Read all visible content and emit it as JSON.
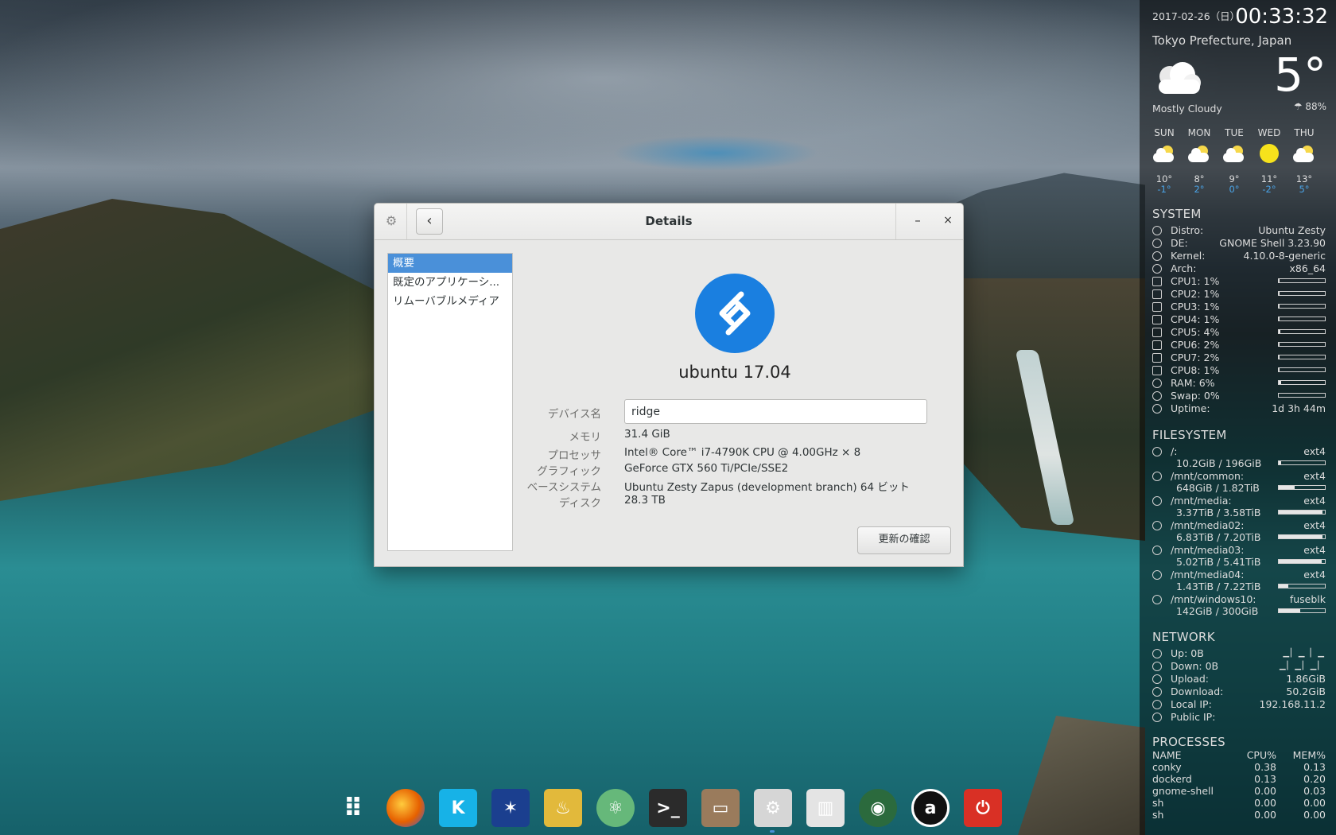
{
  "window": {
    "title": "Details",
    "sidebar_items": [
      "概要",
      "既定のアプリケーシ...",
      "リムーバブルメディア"
    ],
    "os_name": "ubuntu 17.04",
    "labels": {
      "device_name": "デバイス名",
      "memory": "メモリ",
      "processor": "プロセッサ",
      "graphics": "グラフィック",
      "base_system": "ベースシステム",
      "disk": "ディスク"
    },
    "values": {
      "device_name": "ridge",
      "memory": "31.4 GiB",
      "processor": "Intel® Core™ i7-4790K CPU @ 4.00GHz × 8",
      "graphics": "GeForce GTX 560 Ti/PCIe/SSE2",
      "base_system": "Ubuntu Zesty Zapus (development branch) 64 ビット",
      "disk": "28.3 TB"
    },
    "update_button": "更新の確認",
    "minimize_glyph": "–",
    "close_glyph": "×",
    "back_glyph": "‹",
    "gear_glyph": "⚙"
  },
  "conky": {
    "date": "2017-02-26（日）",
    "time": "00:33:32",
    "location": "Tokyo Prefecture, Japan",
    "temp": "5°",
    "condition": "Mostly Cloudy",
    "humidity": "☂ 88%",
    "forecast": [
      {
        "day": "SUN",
        "hi": "10°",
        "lo": "-1°",
        "icon": "partly-cloudy-icon"
      },
      {
        "day": "MON",
        "hi": "8°",
        "lo": "2°",
        "icon": "partly-cloudy-icon"
      },
      {
        "day": "TUE",
        "hi": "9°",
        "lo": "0°",
        "icon": "partly-cloudy-icon"
      },
      {
        "day": "WED",
        "hi": "11°",
        "lo": "-2°",
        "icon": "sunny-icon"
      },
      {
        "day": "THU",
        "hi": "13°",
        "lo": "5°",
        "icon": "partly-cloudy-icon"
      }
    ],
    "system_title": "SYSTEM",
    "system": [
      {
        "label": "Distro:",
        "value": "Ubuntu Zesty"
      },
      {
        "label": "DE:",
        "value": "GNOME Shell 3.23.90"
      },
      {
        "label": "Kernel:",
        "value": "4.10.0-8-generic"
      },
      {
        "label": "Arch:",
        "value": "x86_64"
      }
    ],
    "cpus": [
      {
        "label": "CPU1: 1%",
        "pct": 1
      },
      {
        "label": "CPU2: 1%",
        "pct": 1
      },
      {
        "label": "CPU3: 1%",
        "pct": 1
      },
      {
        "label": "CPU4: 1%",
        "pct": 1
      },
      {
        "label": "CPU5: 4%",
        "pct": 4
      },
      {
        "label": "CPU6: 2%",
        "pct": 2
      },
      {
        "label": "CPU7: 2%",
        "pct": 2
      },
      {
        "label": "CPU8: 1%",
        "pct": 1
      }
    ],
    "ram": {
      "label": "RAM: 6%",
      "pct": 6
    },
    "swap": {
      "label": "Swap: 0%",
      "pct": 0
    },
    "uptime": {
      "label": "Uptime:",
      "value": "1d 3h 44m"
    },
    "fs_title": "FILESYSTEM",
    "filesystems": [
      {
        "mount": "/:",
        "type": "ext4",
        "usage": "10.2GiB / 196GiB",
        "pct": 5
      },
      {
        "mount": "/mnt/common:",
        "type": "ext4",
        "usage": "648GiB / 1.82TiB",
        "pct": 35
      },
      {
        "mount": "/mnt/media:",
        "type": "ext4",
        "usage": "3.37TiB / 3.58TiB",
        "pct": 94
      },
      {
        "mount": "/mnt/media02:",
        "type": "ext4",
        "usage": "6.83TiB / 7.20TiB",
        "pct": 95
      },
      {
        "mount": "/mnt/media03:",
        "type": "ext4",
        "usage": "5.02TiB / 5.41TiB",
        "pct": 93
      },
      {
        "mount": "/mnt/media04:",
        "type": "ext4",
        "usage": "1.43TiB / 7.22TiB",
        "pct": 20
      },
      {
        "mount": "/mnt/windows10:",
        "type": "fuseblk",
        "usage": "142GiB / 300GiB",
        "pct": 47
      }
    ],
    "net_title": "NETWORK",
    "network": [
      {
        "label": "Up: 0B",
        "value": ""
      },
      {
        "label": "Down: 0B",
        "value": ""
      },
      {
        "label": "Upload:",
        "value": "1.86GiB"
      },
      {
        "label": "Download:",
        "value": "50.2GiB"
      },
      {
        "label": "Local IP:",
        "value": "192.168.11.2"
      },
      {
        "label": "Public IP:",
        "value": ""
      }
    ],
    "proc_title": "PROCESSES",
    "proc_header": {
      "name": "NAME",
      "cpu": "CPU%",
      "mem": "MEM%"
    },
    "processes": [
      {
        "name": "conky",
        "cpu": "0.38",
        "mem": "0.13"
      },
      {
        "name": "dockerd",
        "cpu": "0.13",
        "mem": "0.20"
      },
      {
        "name": "gnome-shell",
        "cpu": "0.00",
        "mem": "0.03"
      },
      {
        "name": "sh",
        "cpu": "0.00",
        "mem": "0.00"
      },
      {
        "name": "sh",
        "cpu": "0.00",
        "mem": "0.00"
      }
    ]
  },
  "dock": [
    {
      "name": "app-grid-icon",
      "color": "#ffffff"
    },
    {
      "name": "firefox-icon",
      "color": "#e66000"
    },
    {
      "name": "kodi-icon",
      "color": "#17b2e7"
    },
    {
      "name": "battle-net-icon",
      "color": "#1b3f8f"
    },
    {
      "name": "genie-lamp-icon",
      "color": "#e2b93b"
    },
    {
      "name": "atom-icon",
      "color": "#66b87a"
    },
    {
      "name": "terminal-icon",
      "color": "#2b2b2b"
    },
    {
      "name": "file-manager-icon",
      "color": "#9a7b5c"
    },
    {
      "name": "system-tools-icon",
      "color": "#d6d6d6"
    },
    {
      "name": "mixer-icon",
      "color": "#e4e4e4"
    },
    {
      "name": "camera-icon",
      "color": "#2b6a3d"
    },
    {
      "name": "amazon-icon",
      "color": "#111111"
    },
    {
      "name": "power-icon",
      "color": "#d93025"
    }
  ]
}
